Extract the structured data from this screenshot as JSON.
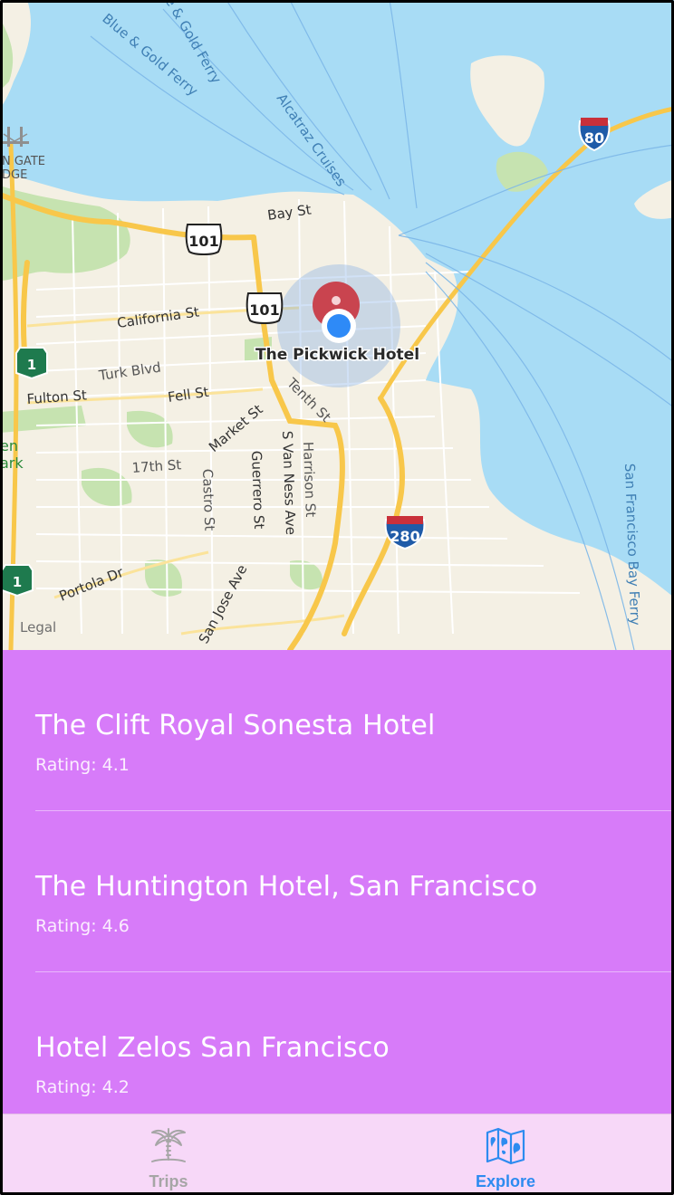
{
  "map": {
    "labels": {
      "ferry1": "Blue & Gold Ferry",
      "ferry2": "e & Gold Ferry",
      "alcatraz": "Alcatraz Cruises",
      "golden_gate_1": "N GATE",
      "golden_gate_2": "DGE",
      "bay_st": "Bay St",
      "california_st": "California St",
      "turk_blvd": "Turk Blvd",
      "fulton_st": "Fulton St",
      "fell_st": "Fell St",
      "tenth_st": "Tenth St",
      "market_st": "Market St",
      "st17": "17th St",
      "castro_st": "Castro St",
      "guerrero_st": "Guerrero St",
      "s_van_ness": "S Van Ness Ave",
      "harrison_st": "Harrison St",
      "portola_dr": "Portola Dr",
      "san_jose_ave": "San Jose Ave",
      "sf_bay_ferry": "San Francisco Bay Ferry",
      "park1": "en",
      "park2": "ark",
      "legal": "Legal",
      "pin_label": "The Pickwick Hotel"
    },
    "shields": {
      "us101_a": "101",
      "us101_b": "101",
      "i80": "80",
      "i280": "280",
      "ca1_a": "1",
      "ca1_b": "1"
    },
    "colors": {
      "water": "#a8dcf5",
      "land": "#f4f0e4",
      "park": "#c6e3b0",
      "freeway": "#f8c74a",
      "pin": "#c9444f",
      "user_dot": "#2e8af7"
    }
  },
  "hotels": [
    {
      "name": "The Clift Royal Sonesta Hotel",
      "rating_label": "Rating:",
      "rating": "4.1"
    },
    {
      "name": "The Huntington Hotel, San Francisco",
      "rating_label": "Rating:",
      "rating": "4.6"
    },
    {
      "name": "Hotel Zelos San Francisco",
      "rating_label": "Rating:",
      "rating": "4.2"
    }
  ],
  "tabbar": {
    "trips": {
      "label": "Trips",
      "icon": "palm-tree-icon",
      "color": "#a6a6a6"
    },
    "explore": {
      "label": "Explore",
      "icon": "map-icon",
      "color": "#2d8bf0",
      "selected": true
    }
  }
}
